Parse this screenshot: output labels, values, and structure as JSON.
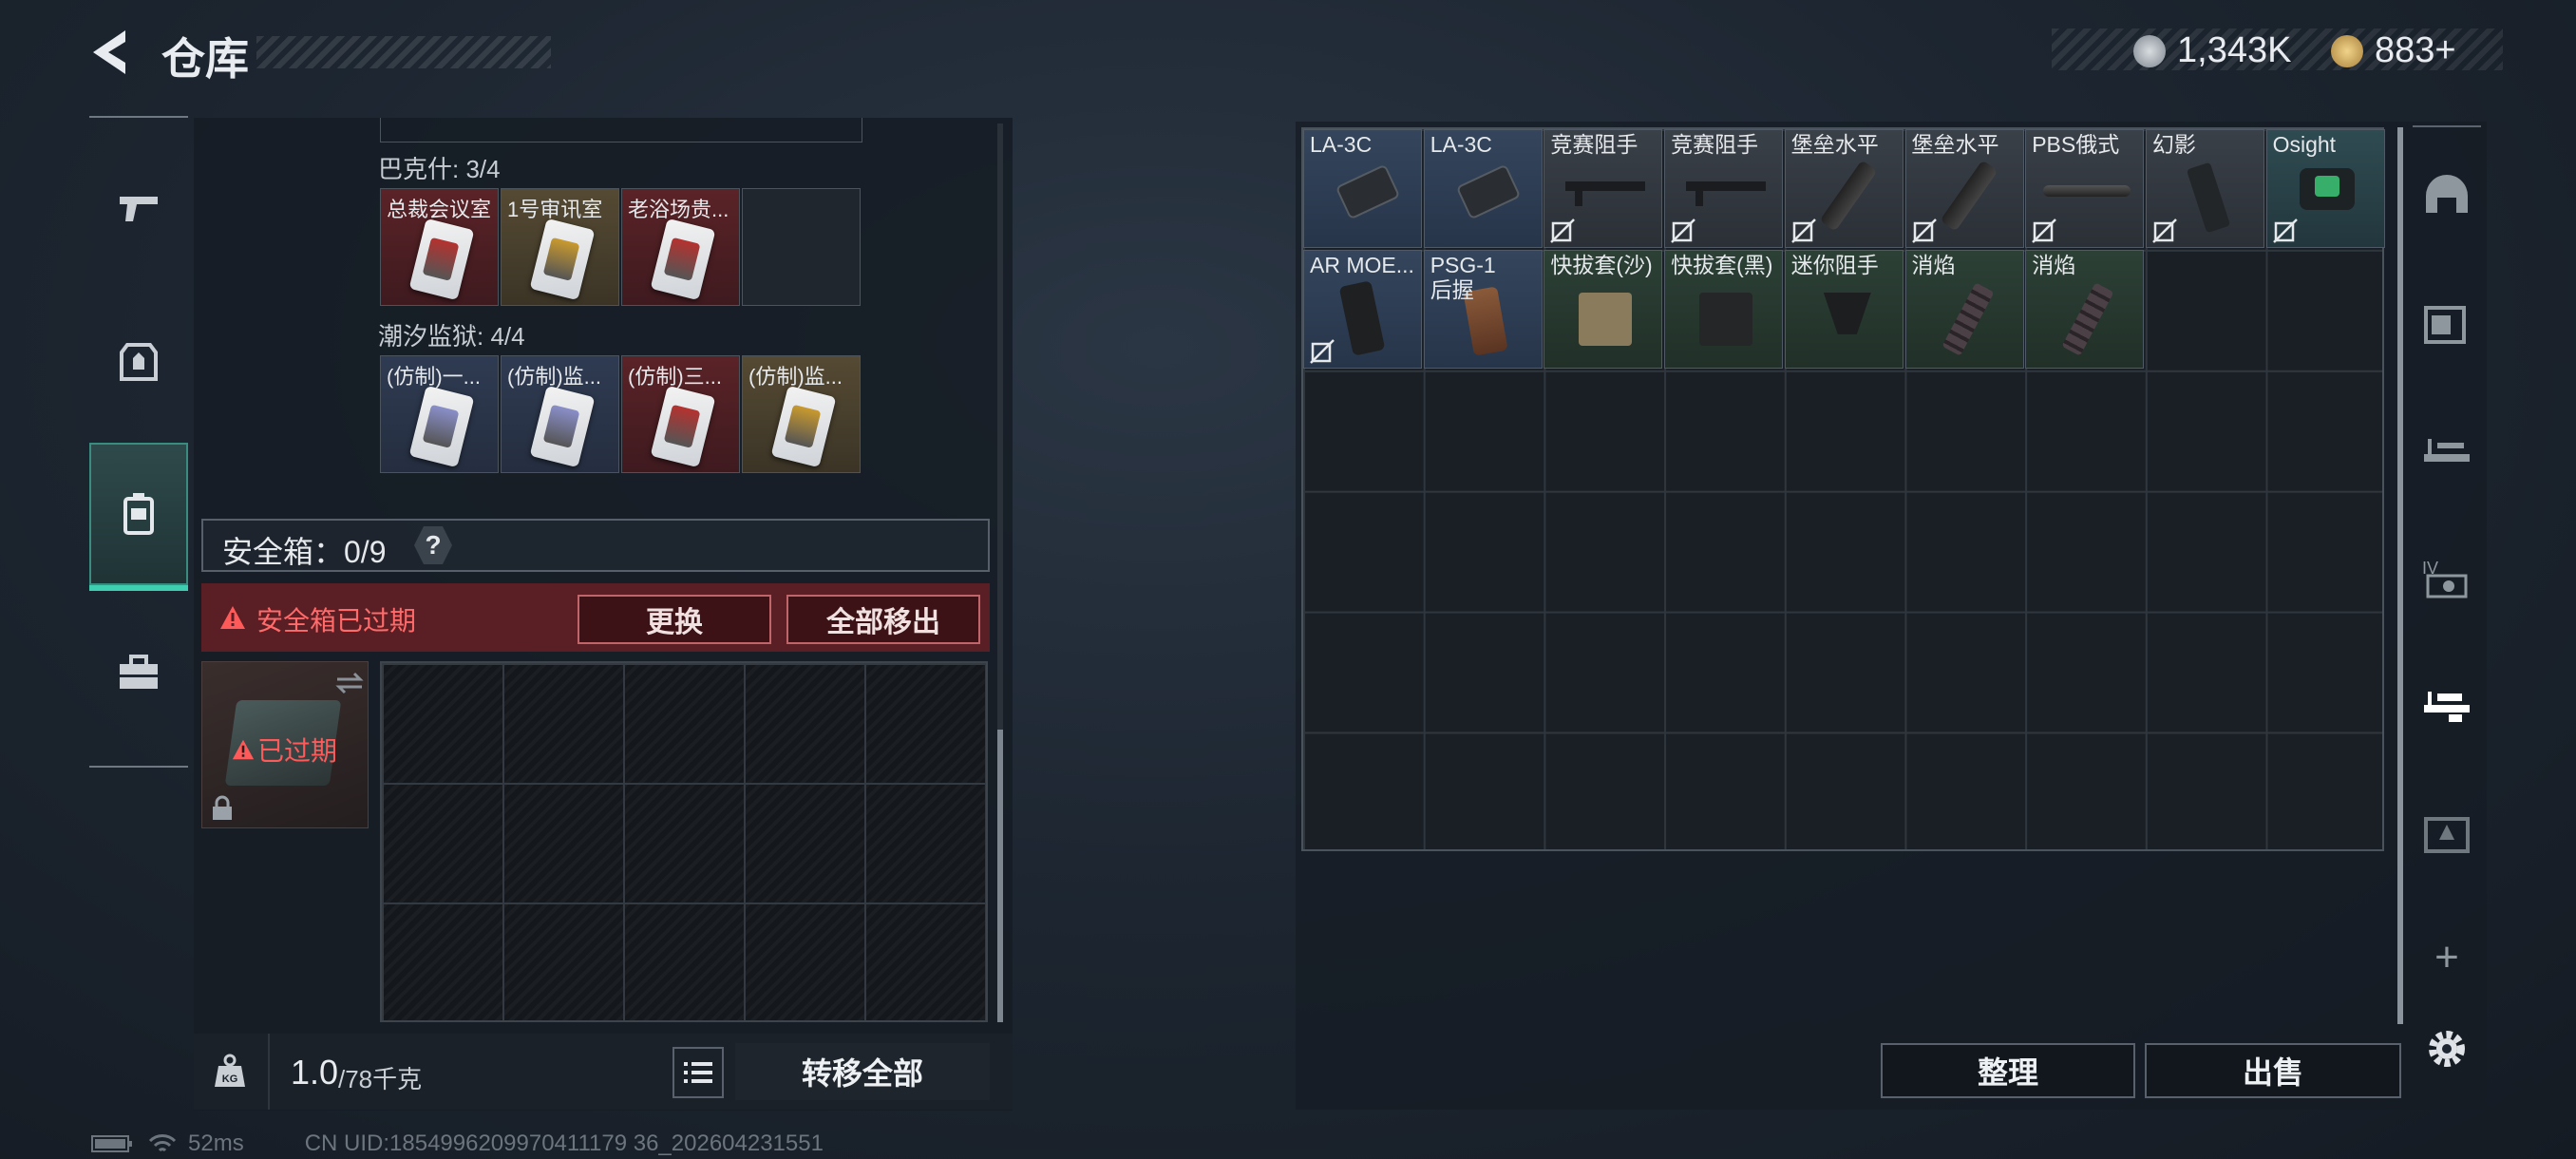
{
  "header": {
    "title": "仓库"
  },
  "currency": {
    "silver": "1,343K",
    "gold": "883+"
  },
  "left_rail": [
    {
      "name": "weapons"
    },
    {
      "name": "armor"
    },
    {
      "name": "backpack",
      "active": true
    },
    {
      "name": "toolbox"
    }
  ],
  "key_groups": [
    {
      "title": "巴克什: 3/4",
      "cards": [
        {
          "label": "总裁会议室",
          "color": "red"
        },
        {
          "label": "1号审讯室",
          "color": "gold"
        },
        {
          "label": "老浴场贵...",
          "color": "red"
        },
        {
          "label": "",
          "color": "empty"
        }
      ]
    },
    {
      "title": "潮汐监狱: 4/4",
      "cards": [
        {
          "label": "(仿制)一...",
          "color": "blue"
        },
        {
          "label": "(仿制)监...",
          "color": "blue"
        },
        {
          "label": "(仿制)三...",
          "color": "red"
        },
        {
          "label": "(仿制)监...",
          "color": "gold"
        }
      ]
    }
  ],
  "safe_box": {
    "title": "安全箱：0/9",
    "help": "?",
    "warning": "安全箱已过期",
    "replace_label": "更换",
    "remove_all_label": "全部移出",
    "expired_badge": "已过期"
  },
  "footer_left": {
    "weight": "1.0",
    "weight_cap": "/78千克",
    "transfer_all": "转移全部"
  },
  "items": [
    {
      "label": "LA-3C",
      "style": "blue",
      "locked": false,
      "kind": "grip"
    },
    {
      "label": "LA-3C",
      "style": "blue",
      "locked": false,
      "kind": "grip"
    },
    {
      "label": "竞赛阻手",
      "style": "gray",
      "locked": true,
      "kind": "rail"
    },
    {
      "label": "竞赛阻手",
      "style": "gray",
      "locked": true,
      "kind": "rail"
    },
    {
      "label": "堡垒水平",
      "style": "gray",
      "locked": true,
      "kind": "vertical"
    },
    {
      "label": "堡垒水平",
      "style": "gray",
      "locked": true,
      "kind": "vertical"
    },
    {
      "label": "PBS俄式",
      "style": "gray",
      "locked": true,
      "kind": "suppressor"
    },
    {
      "label": "幻影",
      "style": "gray",
      "locked": true,
      "kind": "stock"
    },
    {
      "label": "Osight",
      "style": "teal",
      "locked": true,
      "kind": "sight"
    },
    {
      "label": "AR MOE...",
      "style": "blue",
      "locked": true,
      "kind": "pistolgrip"
    },
    {
      "label": "PSG-1\n后握",
      "style": "blue",
      "locked": false,
      "kind": "woodgrip"
    },
    {
      "label": "快拔套(沙)",
      "style": "green",
      "locked": false,
      "kind": "holster"
    },
    {
      "label": "快拔套(黑)",
      "style": "green",
      "locked": false,
      "kind": "holster-dark"
    },
    {
      "label": "迷你阻手",
      "style": "green",
      "locked": false,
      "kind": "minigrip"
    },
    {
      "label": "消焰",
      "style": "green",
      "locked": false,
      "kind": "flash"
    },
    {
      "label": "消焰",
      "style": "green",
      "locked": false,
      "kind": "flash"
    }
  ],
  "right_buttons": {
    "sort": "整理",
    "sell": "出售"
  },
  "right_rail": [
    "helmet",
    "armor-rig",
    "gun-rack",
    "scope-rack",
    "weapon-mods",
    "loot-crate",
    "add",
    "settings"
  ],
  "status": {
    "ping": "52ms",
    "uid": "CN UID:1854996209970411179 36_202604231551"
  }
}
